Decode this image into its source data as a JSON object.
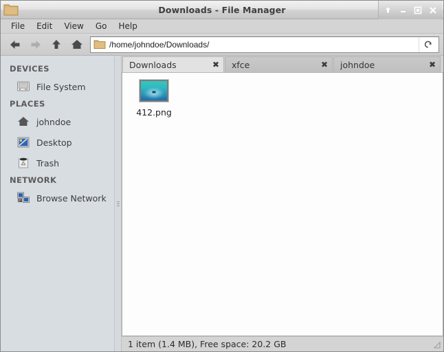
{
  "window": {
    "title": "Downloads - File Manager",
    "icon": "folder-icon",
    "controls": [
      {
        "name": "shade-button",
        "icon": "arrow-up-icon",
        "label": "⇧"
      },
      {
        "name": "minimize-button",
        "icon": "minimize-icon",
        "label": "–"
      },
      {
        "name": "maximize-button",
        "icon": "maximize-icon",
        "label": "□"
      },
      {
        "name": "close-button",
        "icon": "close-icon",
        "label": "✕"
      }
    ]
  },
  "menubar": {
    "items": [
      {
        "label": "File"
      },
      {
        "label": "Edit"
      },
      {
        "label": "View"
      },
      {
        "label": "Go"
      },
      {
        "label": "Help"
      }
    ]
  },
  "toolbar": {
    "buttons": [
      {
        "name": "back-button",
        "icon": "arrow-left-icon",
        "enabled": true
      },
      {
        "name": "forward-button",
        "icon": "arrow-right-icon",
        "enabled": false
      },
      {
        "name": "up-button",
        "icon": "arrow-up-icon",
        "enabled": true
      },
      {
        "name": "home-button",
        "icon": "home-icon",
        "enabled": true
      }
    ],
    "path_value": "/home/johndoe/Downloads/",
    "path_placeholder": "Location",
    "path_icon": "folder-icon",
    "reload_icon": "reload-icon"
  },
  "sidebar": {
    "groups": [
      {
        "heading": "DEVICES",
        "items": [
          {
            "label": "File System",
            "icon": "drive-harddisk-icon"
          }
        ]
      },
      {
        "heading": "PLACES",
        "items": [
          {
            "label": "johndoe",
            "icon": "user-home-icon"
          },
          {
            "label": "Desktop",
            "icon": "desktop-icon"
          },
          {
            "label": "Trash",
            "icon": "trash-icon"
          }
        ]
      },
      {
        "heading": "NETWORK",
        "items": [
          {
            "label": "Browse Network",
            "icon": "network-workgroup-icon"
          }
        ]
      }
    ]
  },
  "tabs": [
    {
      "label": "Downloads",
      "active": true,
      "close_label": "✖"
    },
    {
      "label": "xfce",
      "active": false,
      "close_label": "✖"
    },
    {
      "label": "johndoe",
      "active": false,
      "close_label": "✖"
    }
  ],
  "fileview": {
    "items": [
      {
        "name": "412.png",
        "icon": "image-thumbnail"
      }
    ]
  },
  "statusbar": {
    "text": "1 item (1.4 MB), Free space: 20.2 GB",
    "grip_icon": "resize-grip-icon"
  },
  "colors": {
    "window_bg": "#d6d6d6",
    "sidebar_bg": "#d8dde2",
    "fileview_bg": "#fdfdfd",
    "active_tab_bg": "#e2e2e2",
    "thumbnail_accent": "#2fb9bf"
  }
}
